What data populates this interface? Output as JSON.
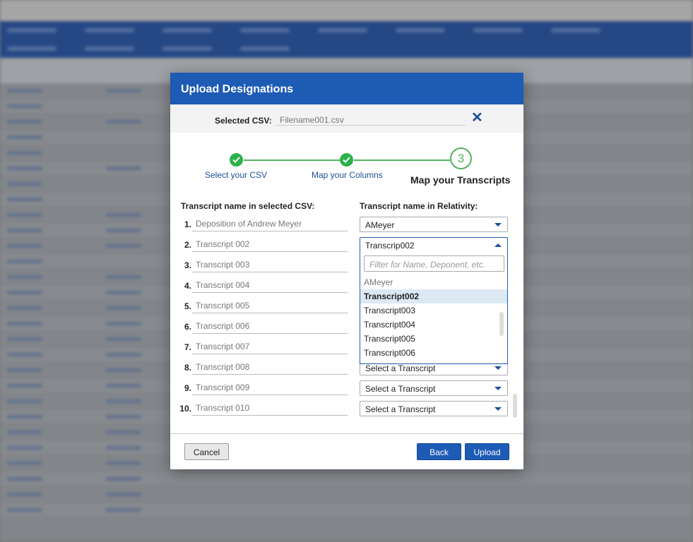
{
  "modal": {
    "title": "Upload Designations",
    "selected_csv_label": "Selected CSV:",
    "selected_csv_value": "Filename001.csv",
    "close_symbol": "✕"
  },
  "stepper": {
    "steps": [
      {
        "label": "Select your CSV",
        "status": "complete"
      },
      {
        "label": "Map your Columns",
        "status": "complete"
      },
      {
        "label": "Map your Transcripts",
        "status": "current",
        "number": "3"
      }
    ]
  },
  "columns": {
    "left_header": "Transcript name in selected CSV:",
    "right_header": "Transcript name in Relativity:"
  },
  "rows": [
    {
      "num": "1.",
      "csv_name": "Deposition of Andrew Meyer",
      "relativity": "AMeyer"
    },
    {
      "num": "2.",
      "csv_name": "Transcript 002",
      "relativity": "Transcrip002"
    },
    {
      "num": "3.",
      "csv_name": "Transcript 003",
      "relativity": ""
    },
    {
      "num": "4.",
      "csv_name": "Transcript 004",
      "relativity": ""
    },
    {
      "num": "5.",
      "csv_name": "Transcript 005",
      "relativity": ""
    },
    {
      "num": "6.",
      "csv_name": "Transcript 006",
      "relativity": ""
    },
    {
      "num": "7.",
      "csv_name": "Transcript 007",
      "relativity": ""
    },
    {
      "num": "8.",
      "csv_name": "Transcript 008",
      "relativity": "Select a Transcript"
    },
    {
      "num": "9.",
      "csv_name": "Transcript 009",
      "relativity": "Select a Transcript"
    },
    {
      "num": "10.",
      "csv_name": "Transcript 010",
      "relativity": "Select a Transcript"
    }
  ],
  "dropdown": {
    "filter_placeholder": "Filter for Name, Deponent, etc.",
    "options": [
      {
        "label": "AMeyer",
        "state": "muted"
      },
      {
        "label": "Transcript002",
        "state": "selected"
      },
      {
        "label": "Transcript003",
        "state": "normal"
      },
      {
        "label": "Transcript004",
        "state": "normal"
      },
      {
        "label": "Transcript005",
        "state": "normal"
      },
      {
        "label": "Transcript006",
        "state": "normal"
      }
    ]
  },
  "footer": {
    "cancel_label": "Cancel",
    "back_label": "Back",
    "upload_label": "Upload"
  },
  "colors": {
    "header_blue": "#1d5bb5",
    "link_blue": "#1d4f97",
    "step_green": "#2bb249",
    "selected_option_bg": "#dde8f5"
  }
}
